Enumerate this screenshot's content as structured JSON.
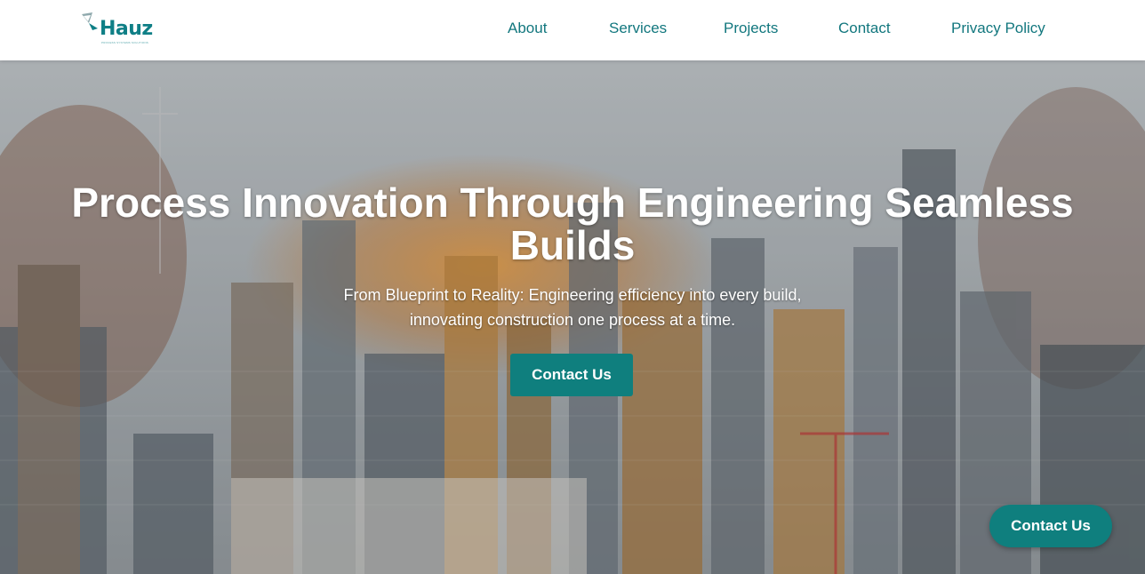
{
  "brand": {
    "name": "Hauz",
    "tagline": "PROCESS SYSTEMS SOLUTIONS",
    "color": "#0f7f86"
  },
  "nav": {
    "items": [
      {
        "label": "About"
      },
      {
        "label": "Services"
      },
      {
        "label": "Projects"
      },
      {
        "label": "Contact"
      },
      {
        "label": "Privacy Policy"
      }
    ]
  },
  "hero": {
    "title": "Process Innovation Through Engineering Seamless Builds",
    "subtitle_line1": "From Blueprint to Reality: Engineering efficiency into every build,",
    "subtitle_line2": "innovating construction one process at a time.",
    "cta_label": "Contact Us",
    "background": "city-construction-collage"
  },
  "floating_cta": {
    "label": "Contact Us"
  },
  "colors": {
    "accent": "#0f7f7e",
    "nav_text": "#12777e",
    "hero_text": "#ffffff"
  }
}
